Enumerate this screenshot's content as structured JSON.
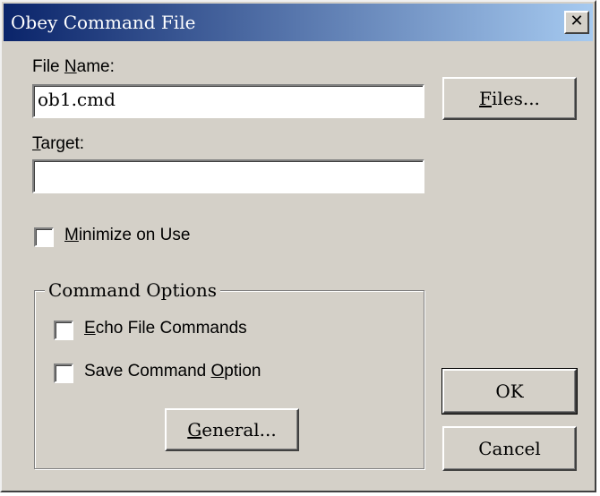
{
  "window": {
    "title": "Obey Command File"
  },
  "close_symbol": "✕",
  "file_name": {
    "label_pre": "File ",
    "label_mnemonic": "N",
    "label_post": "ame:",
    "value": "ob1.cmd"
  },
  "files_button": {
    "mnemonic": "F",
    "rest": "iles..."
  },
  "target": {
    "label_mnemonic": "T",
    "label_post": "arget:",
    "value": ""
  },
  "minimize": {
    "mnemonic": "M",
    "rest": "inimize on Use",
    "checked": false
  },
  "command_options": {
    "title": "Command Options",
    "echo": {
      "mnemonic": "E",
      "rest": "cho File Commands",
      "checked": false
    },
    "save": {
      "pre": "Save Command ",
      "mnemonic": "O",
      "post": "ption",
      "checked": false
    },
    "general_button": {
      "mnemonic": "G",
      "rest": "eneral..."
    }
  },
  "ok_label": "OK",
  "cancel_label": "Cancel"
}
